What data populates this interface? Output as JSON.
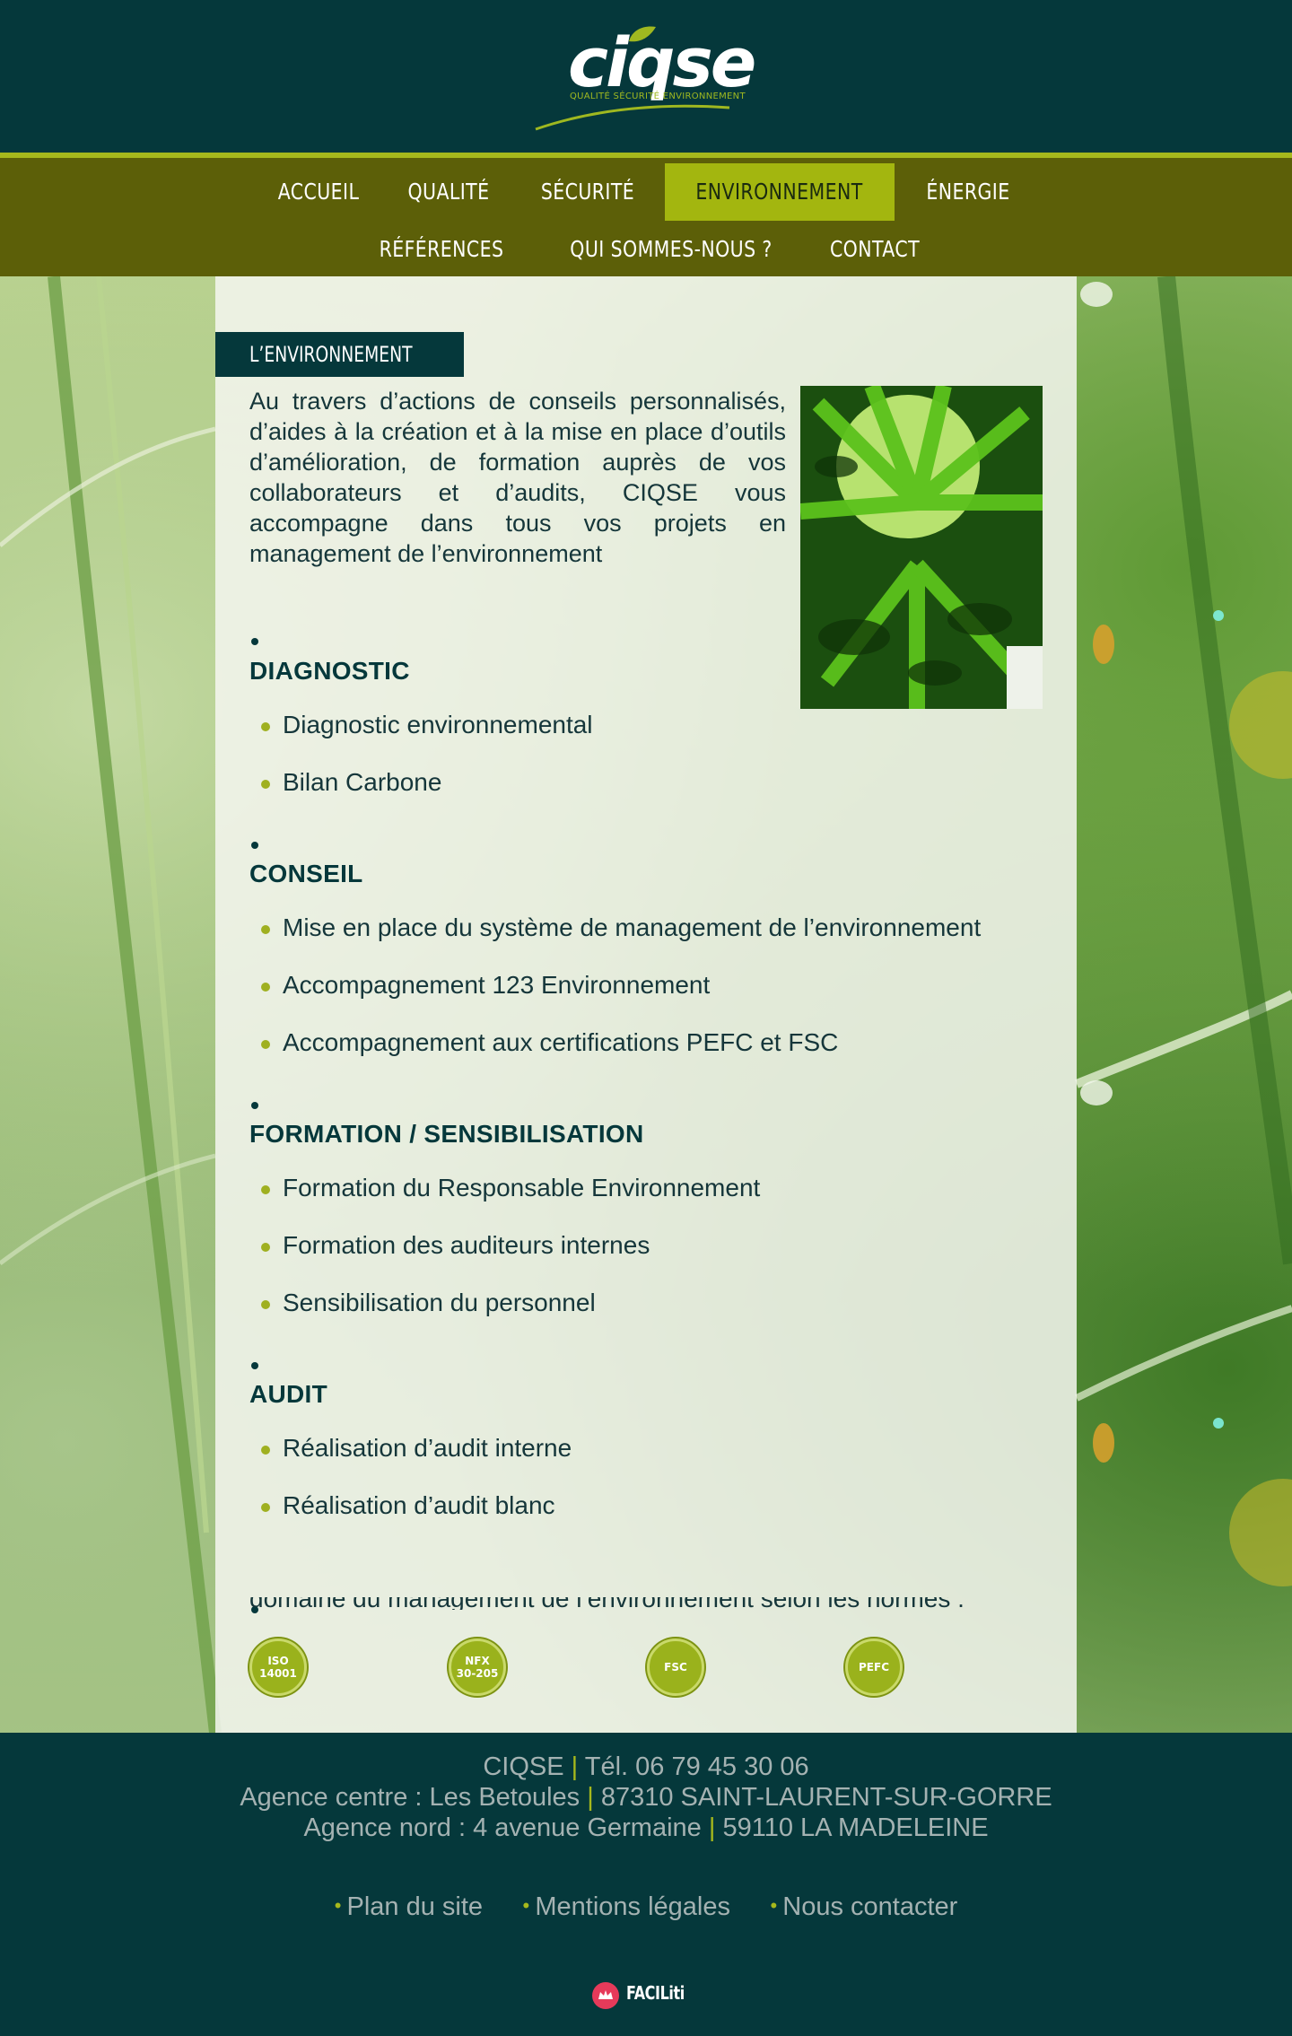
{
  "brand": {
    "name": "ciqse",
    "tagline": "QUALITÉ SÉCURITÉ ENVIRONNEMENT"
  },
  "nav": {
    "row1": [
      {
        "label": "ACCUEIL"
      },
      {
        "label": "QUALITÉ"
      },
      {
        "label": "SÉCURITÉ"
      },
      {
        "label": "ENVIRONNEMENT",
        "active": true
      },
      {
        "label": "ÉNERGIE"
      }
    ],
    "row2": [
      {
        "label": "RÉFÉRENCES"
      },
      {
        "label": "QUI SOMMES-NOUS ?"
      },
      {
        "label": "CONTACT"
      }
    ]
  },
  "page": {
    "section_title": "L’ENVIRONNEMENT",
    "intro": "Au travers d’actions de conseils personnalisés, d’aides à la création et à la mise en place d’outils d’amélioration, de formation auprès de vos collaborateurs et d’audits, CIQSE vous accompagne dans tous vos projets en management de l’environnement",
    "groups": [
      {
        "title": "DIAGNOSTIC",
        "items": [
          "Diagnostic environnemental",
          "Bilan Carbone"
        ]
      },
      {
        "title": "CONSEIL",
        "items": [
          "Mise en place du système de management de l’environnement",
          "Accompagnement 123 Environnement",
          "Accompagnement aux certifications PEFC et FSC"
        ]
      },
      {
        "title": "FORMATION / SENSIBILISATION",
        "items": [
          "Formation du Responsable Environnement",
          "Formation des auditeurs internes",
          "Sensibilisation du personnel"
        ]
      },
      {
        "title": "AUDIT",
        "items": [
          "Réalisation d’audit interne",
          "Réalisation d’audit blanc"
        ]
      }
    ],
    "cut_text": "domaine du management de l’environnement selon les normes :",
    "badges": [
      "ISO\n14001",
      "NFX\n30-205",
      "FSC",
      "PEFC"
    ]
  },
  "footer": {
    "company": "CIQSE",
    "phone": "Tél. 06 79 45 30 06",
    "agency_center": "Agence centre : Les Betoules",
    "agency_center_city": "87310 SAINT-LAURENT-SUR-GORRE",
    "agency_north": "Agence nord : 4 avenue Germaine",
    "agency_north_city": "59110 LA MADELEINE",
    "separator": "|",
    "links": [
      "Plan du site",
      "Mentions légales",
      "Nous contacter"
    ],
    "faciliti": "FACILiti"
  },
  "colors": {
    "dark_teal": "#05383b",
    "olive_nav": "#5c5f08",
    "lime_accent": "#a3b60f"
  }
}
